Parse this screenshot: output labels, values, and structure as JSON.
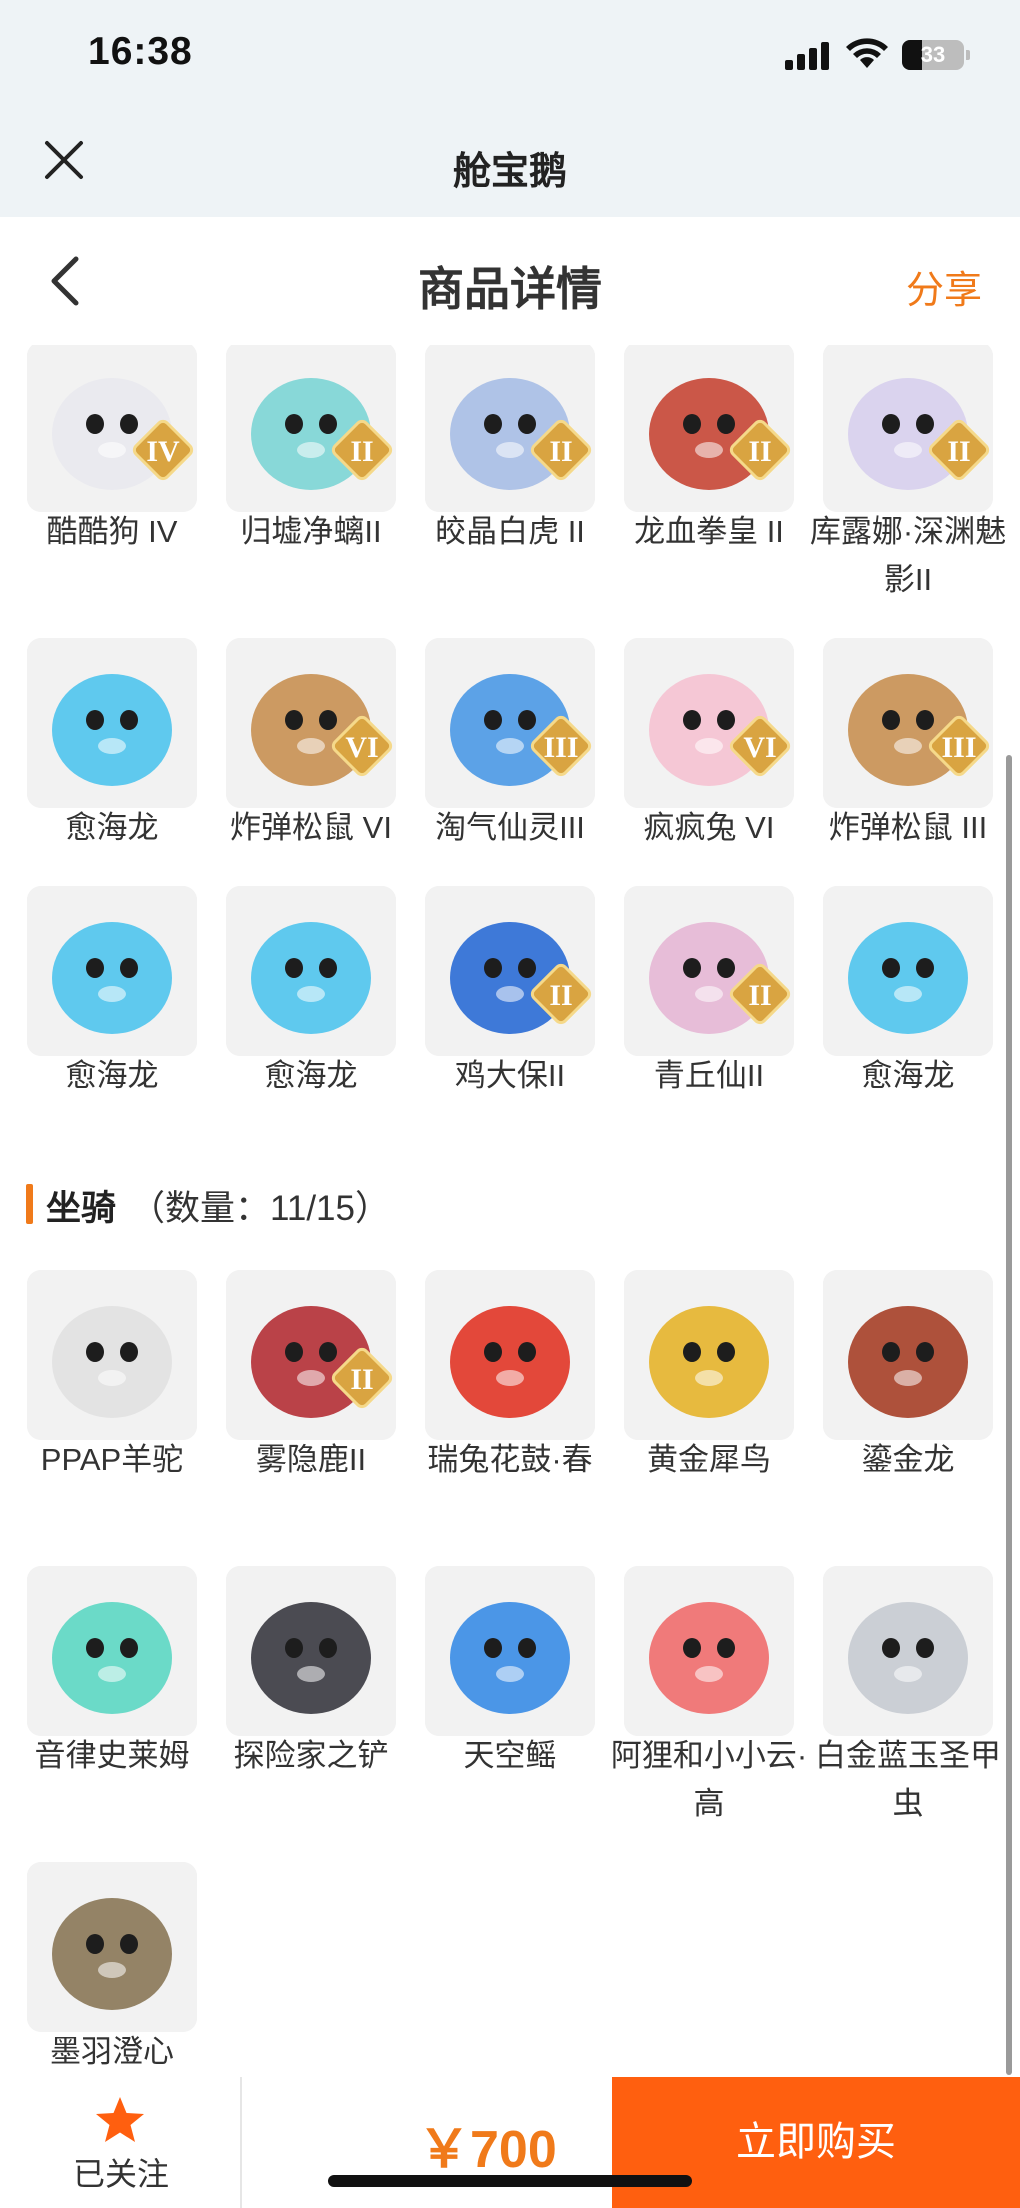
{
  "status_bar": {
    "time": "16:38",
    "battery": "33",
    "battery_level": 0.33
  },
  "miniapp": {
    "title": "舱宝鹅",
    "close_icon": "close-icon"
  },
  "nav": {
    "title": "商品详情",
    "share_label": "分享",
    "back_icon": "chevron-left-icon"
  },
  "pets": [
    {
      "name": "酷酷狗 IV",
      "badge": "IV",
      "icon": "white-bear-goggles",
      "color": "#e9e9ef"
    },
    {
      "name": "归墟净螭II",
      "badge": "II",
      "icon": "ice-dragon",
      "color": "#7fd6d6"
    },
    {
      "name": "皎晶白虎 II",
      "badge": "II",
      "icon": "white-tiger",
      "color": "#a9bfe6"
    },
    {
      "name": "龙血拳皇 II",
      "badge": "II",
      "icon": "red-demon",
      "color": "#c84a3a"
    },
    {
      "name": "库露娜·深渊魅影II",
      "badge": "II",
      "icon": "pale-girl",
      "color": "#d8d0ee"
    },
    {
      "name": "愈海龙",
      "badge": "",
      "icon": "sea-dragon",
      "color": "#52c6ee"
    },
    {
      "name": "炸弹松鼠 VI",
      "badge": "VI",
      "icon": "squirrel",
      "color": "#c99256"
    },
    {
      "name": "淘气仙灵III",
      "badge": "III",
      "icon": "blue-puppy",
      "color": "#4f9be6"
    },
    {
      "name": "疯疯兔 VI",
      "badge": "VI",
      "icon": "pink-rabbit",
      "color": "#f5c3d2"
    },
    {
      "name": "炸弹松鼠 III",
      "badge": "III",
      "icon": "squirrel",
      "color": "#c99256"
    },
    {
      "name": "愈海龙",
      "badge": "",
      "icon": "sea-dragon",
      "color": "#52c6ee"
    },
    {
      "name": "愈海龙",
      "badge": "",
      "icon": "sea-dragon",
      "color": "#52c6ee"
    },
    {
      "name": "鸡大保II",
      "badge": "II",
      "icon": "blue-bird-sunglasses",
      "color": "#2f6fd6"
    },
    {
      "name": "青丘仙II",
      "badge": "II",
      "icon": "fox-girl",
      "color": "#e6b8d6"
    },
    {
      "name": "愈海龙",
      "badge": "",
      "icon": "sea-dragon",
      "color": "#52c6ee"
    }
  ],
  "mounts_section": {
    "label": "坐骑",
    "count_text": "（数量：11/15）"
  },
  "mounts": [
    {
      "name": "PPAP羊驼",
      "badge": "",
      "icon": "alpaca-sunglasses",
      "color": "#e2e2e2"
    },
    {
      "name": "雾隐鹿II",
      "badge": "II",
      "icon": "red-deer",
      "color": "#b5333a"
    },
    {
      "name": "瑞兔花鼓·春",
      "badge": "",
      "icon": "red-drum",
      "color": "#e23a2a"
    },
    {
      "name": "黄金犀鸟",
      "badge": "",
      "icon": "hornbill",
      "color": "#e6b530"
    },
    {
      "name": "鎏金龙",
      "badge": "",
      "icon": "gold-dragon",
      "color": "#a8432b"
    },
    {
      "name": "音律史莱姆",
      "badge": "",
      "icon": "slime",
      "color": "#5fd8c4"
    },
    {
      "name": "探险家之铲",
      "badge": "",
      "icon": "shovel",
      "color": "#3d3d44"
    },
    {
      "name": "天空鳐",
      "badge": "",
      "icon": "sky-ray",
      "color": "#3d8ee6"
    },
    {
      "name": "阿狸和小小云·高",
      "badge": "",
      "icon": "fox-cloud",
      "color": "#f07070"
    },
    {
      "name": "白金蓝玉圣甲虫",
      "badge": "",
      "icon": "beetle",
      "color": "#c8ccd2"
    },
    {
      "name": "墨羽澄心",
      "badge": "",
      "icon": "feather-staff",
      "color": "#8c7a5a"
    }
  ],
  "bottom_bar": {
    "follow_label": "已关注",
    "price": "￥700",
    "buy_label": "立即购买",
    "accent": "#ff5f0f"
  }
}
